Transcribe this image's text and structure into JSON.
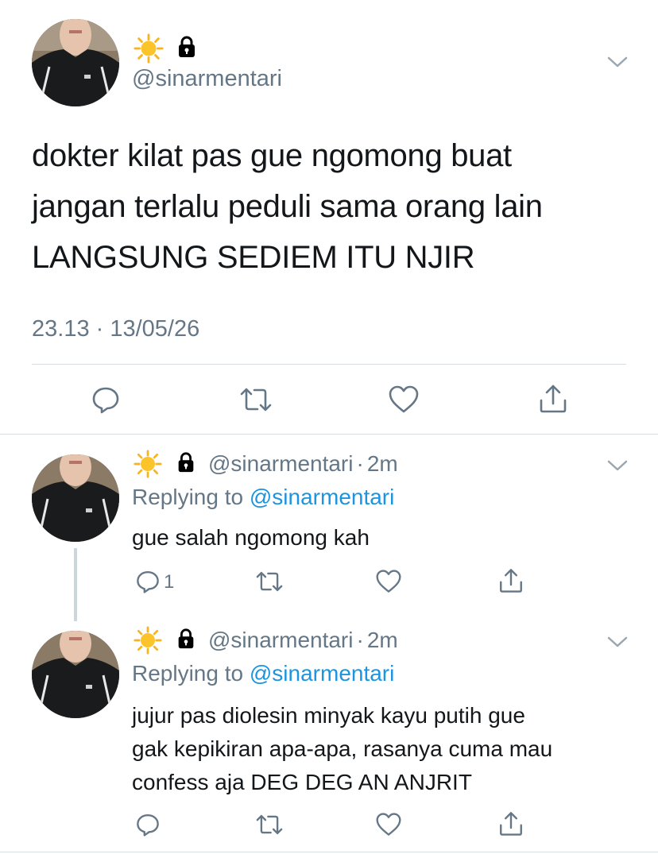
{
  "main_tweet": {
    "handle": "@sinarmentari",
    "text_lines": [
      "dokter kilat pas gue ngomong buat",
      "jangan terlalu peduli sama orang lain",
      "LANGSUNG SEDIEM ITU NJIR"
    ],
    "timestamp": "23.13 · 13/05/26"
  },
  "replies": [
    {
      "handle": "@sinarmentari",
      "time": "2m",
      "separator": "·",
      "replying_prefix": "Replying to",
      "replying_to": "@sinarmentari",
      "text_lines": [
        "gue salah ngomong kah"
      ],
      "reply_count": "1"
    },
    {
      "handle": "@sinarmentari",
      "time": "2m",
      "separator": "·",
      "replying_prefix": "Replying to",
      "replying_to": "@sinarmentari",
      "text_lines": [
        "jujur pas diolesin minyak kayu putih gue",
        "gak kepikiran apa-apa, rasanya cuma mau",
        "confess aja DEG DEG AN ANJRIT"
      ],
      "reply_count": ""
    }
  ],
  "icons": {
    "display_name": [
      "sun-emoji",
      "lock-icon"
    ],
    "actions": [
      "reply-icon",
      "retweet-icon",
      "like-icon",
      "share-icon"
    ],
    "menu": "chevron-down-icon"
  },
  "colors": {
    "text": "#14171a",
    "secondary": "#657786",
    "link": "#1b95e0",
    "divider": "#d8dde1",
    "sun": "#f9b31c"
  }
}
